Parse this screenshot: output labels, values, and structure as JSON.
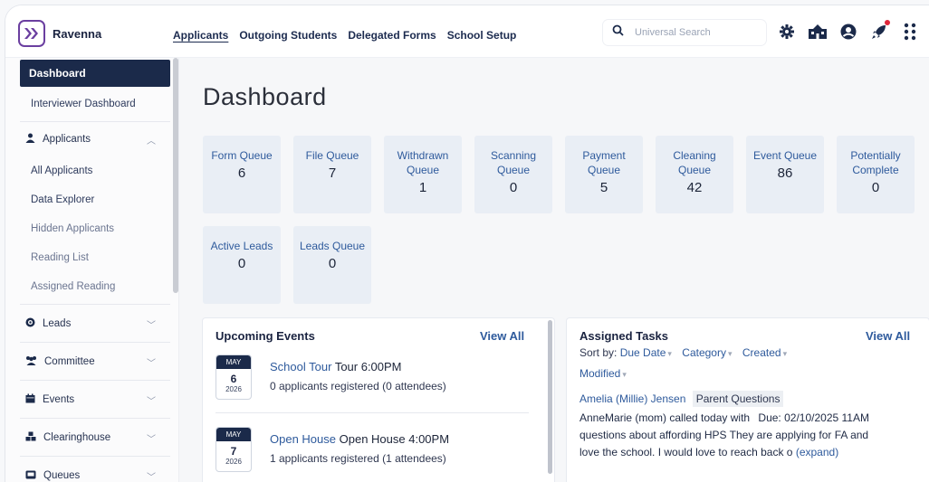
{
  "brand": {
    "name": "Ravenna"
  },
  "nav": {
    "items": [
      "Applicants",
      "Outgoing Students",
      "Delegated Forms",
      "School Setup"
    ]
  },
  "search": {
    "placeholder": "Universal Search"
  },
  "tools": [
    "gear-icon",
    "school-icon",
    "user-circle-icon",
    "rocket-icon",
    "apps-grid-icon"
  ],
  "colors": {
    "primary_dark": "#1b2a4a",
    "link": "#2e5a9c",
    "card_bg": "#e9eef5",
    "brand_purple": "#6b3fa0",
    "alert_dot": "#e0263a"
  },
  "sidebar": {
    "active": "Dashboard",
    "interviewer": "Interviewer Dashboard",
    "applicants_group": "Applicants",
    "applicants_sub": [
      "All Applicants",
      "Data Explorer",
      "Hidden Applicants",
      "Reading List",
      "Assigned Reading"
    ],
    "groups": [
      "Leads",
      "Committee",
      "Events",
      "Clearinghouse",
      "Queues"
    ]
  },
  "main": {
    "title": "Dashboard",
    "queues": [
      {
        "label": "Form Queue",
        "value": "6"
      },
      {
        "label": "File Queue",
        "value": "7"
      },
      {
        "label": "Withdrawn Queue",
        "value": "1"
      },
      {
        "label": "Scanning Queue",
        "value": "0"
      },
      {
        "label": "Payment Queue",
        "value": "5"
      },
      {
        "label": "Cleaning Queue",
        "value": "42"
      },
      {
        "label": "Event Queue",
        "value": "86"
      },
      {
        "label": "Potentially Complete",
        "value": "0"
      },
      {
        "label": "Active Leads",
        "value": "0"
      },
      {
        "label": "Leads Queue",
        "value": "0"
      }
    ]
  },
  "events": {
    "title": "Upcoming Events",
    "view_all": "View All",
    "items": [
      {
        "month": "MAY",
        "day": "6",
        "year": "2026",
        "name": "School Tour",
        "detail": "Tour 6:00PM",
        "registered": "0 applicants registered (0 attendees)"
      },
      {
        "month": "MAY",
        "day": "7",
        "year": "2026",
        "name": "Open House",
        "detail": "Open House 4:00PM",
        "registered": "1 applicants registered (1 attendees)"
      }
    ]
  },
  "tasks": {
    "title": "Assigned Tasks",
    "view_all": "View All",
    "sort_label": "Sort by:",
    "sort_options": [
      "Due Date",
      "Category",
      "Created",
      "Modified"
    ],
    "task": {
      "name": "Amelia (Millie) Jensen",
      "tag": "Parent Questions",
      "line1_text": "AnneMarie (mom) called today with",
      "due": "Due: 02/10/2025 11AM",
      "line2": "questions about affording HPS They are applying for FA and",
      "line3": "love the school. I would love to reach back o",
      "expand": "(expand)"
    }
  }
}
